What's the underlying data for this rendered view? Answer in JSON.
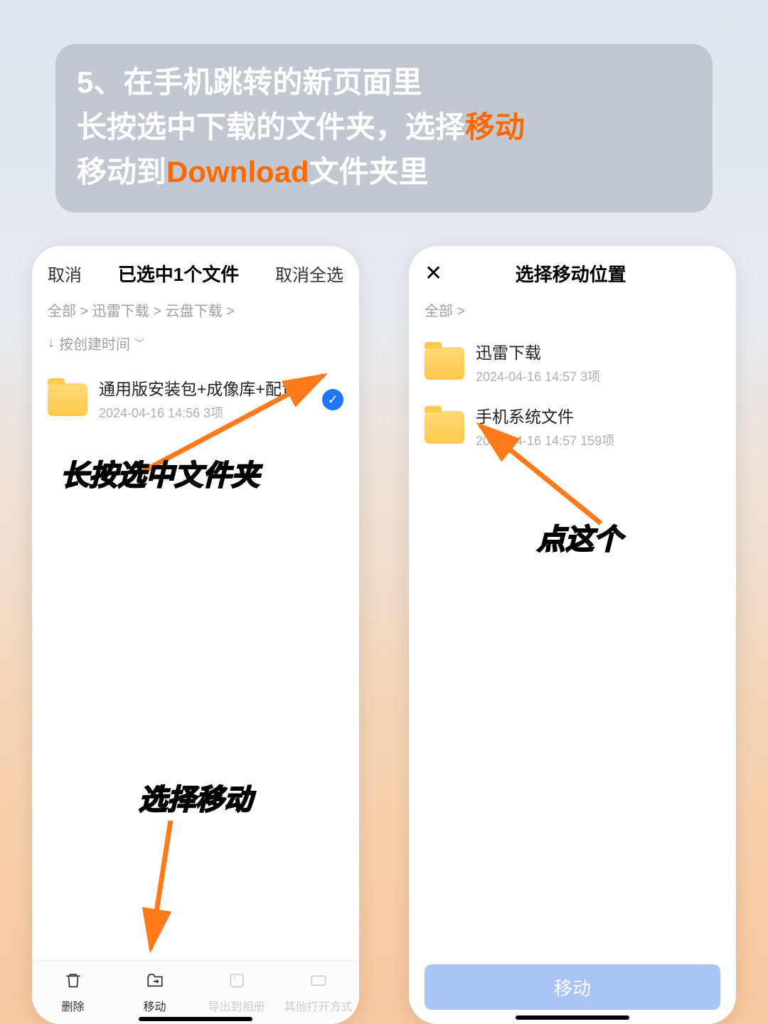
{
  "instruction": {
    "line1": "5、在手机跳转的新页面里",
    "line2a": "长按选中下载的文件夹，选择",
    "line2b": "移动",
    "line3a": "移动到",
    "line3b": "Download",
    "line3c": "文件夹里"
  },
  "phone1": {
    "topbar": {
      "cancel": "取消",
      "title": "已选中1个文件",
      "deselect": "取消全选"
    },
    "breadcrumb": "全部 > 迅雷下载 > 云盘下载 >",
    "sort_arrow": "↓",
    "sort_label": "按创建时间",
    "sort_caret": "﹀",
    "file": {
      "name": "通用版安装包+成像库+配置",
      "meta": "2024-04-16 14:56 3项",
      "check": "✓"
    },
    "annotations": {
      "longpress": "长按选中文件夹",
      "select_move": "选择移动"
    },
    "toolbar": {
      "delete": "删除",
      "move": "移动",
      "export": "导出到相册",
      "other": "其他打开方式"
    }
  },
  "phone2": {
    "topbar": {
      "close": "✕",
      "title": "选择移动位置"
    },
    "breadcrumb": "全部 >",
    "folders": [
      {
        "name": "迅雷下载",
        "meta": "2024-04-16 14:57 3项"
      },
      {
        "name": "手机系统文件",
        "meta": "2024-04-16 14:57 159项"
      }
    ],
    "annotation": "点这个",
    "move_button": "移动"
  }
}
